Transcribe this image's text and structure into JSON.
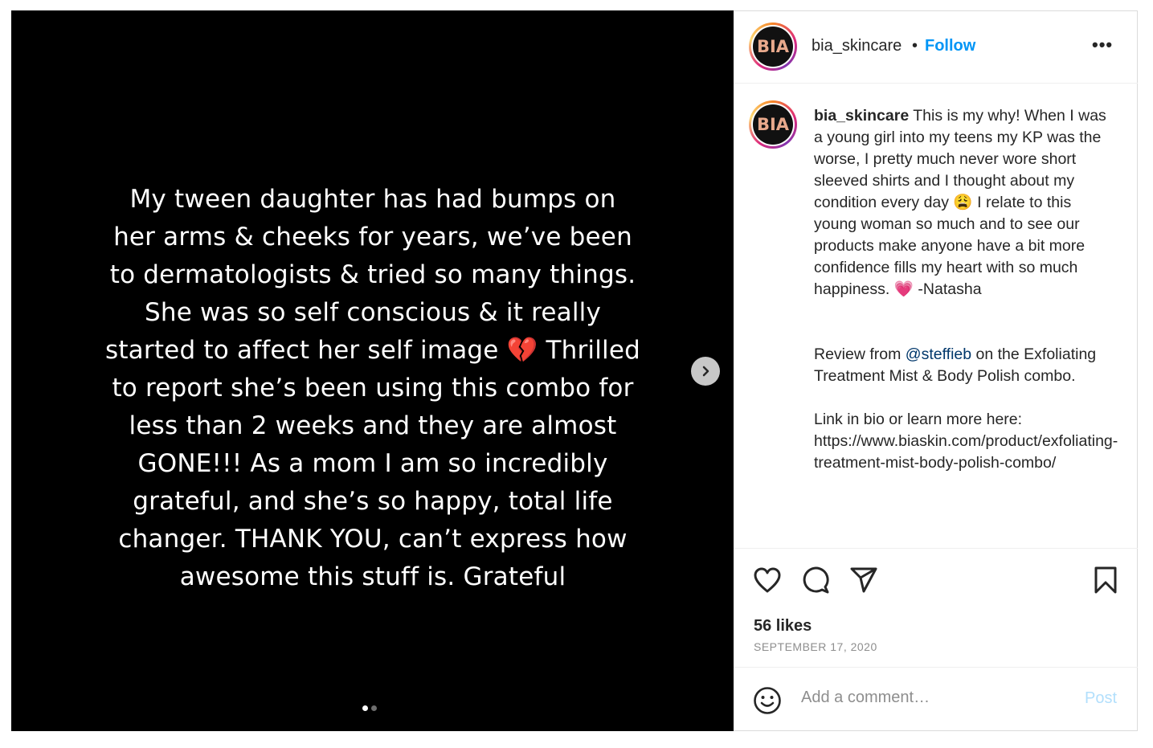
{
  "post": {
    "media": {
      "text_lines": [
        "My tween daughter has had bumps on",
        "her arms & cheeks for years, we’ve been",
        "to dermatologists & tried so many things.",
        "She was so self conscious & it really",
        "started to affect her self image 💔 Thrilled",
        "to report she’s been using this combo for",
        "less than 2 weeks and they are almost",
        "GONE!!! As a mom I am so incredibly",
        "grateful, and she’s so happy, total life",
        "changer. THANK YOU, can’t express how",
        "awesome this stuff is. Grateful"
      ],
      "next_icon": "chevron-right-icon",
      "slides_total": 2,
      "active_slide": 1
    },
    "header": {
      "avatar_text": "BIA",
      "username": "bia_skincare",
      "separator": "•",
      "follow_label": "Follow",
      "more_label": "•••"
    },
    "caption": {
      "avatar_text": "BIA",
      "username": "bia_skincare",
      "text_1": " This is my why! When I was a young girl into my teens my KP was the worse, I pretty much never wore short sleeved shirts and I thought about my condition every day 😩 I relate to this young woman so much and to see our products make anyone have a bit more confidence fills my heart with so much happiness. 💗 -Natasha\n\n\nReview from ",
      "mention": "@steffieb",
      "text_2": " on the Exfoliating Treatment Mist & Body Polish combo.\n\nLink in bio or learn more here: https://www.biaskin.com/product/exfoliating-treatment-mist-body-polish-combo/"
    },
    "actions": {
      "like_icon": "heart-icon",
      "comment_icon": "comment-bubble-icon",
      "share_icon": "paper-plane-icon",
      "save_icon": "bookmark-icon",
      "likes": "56 likes",
      "date": "SEPTEMBER 17, 2020"
    },
    "comment": {
      "emoji_icon": "smiley-icon",
      "placeholder": "Add a comment…",
      "post_label": "Post"
    }
  }
}
